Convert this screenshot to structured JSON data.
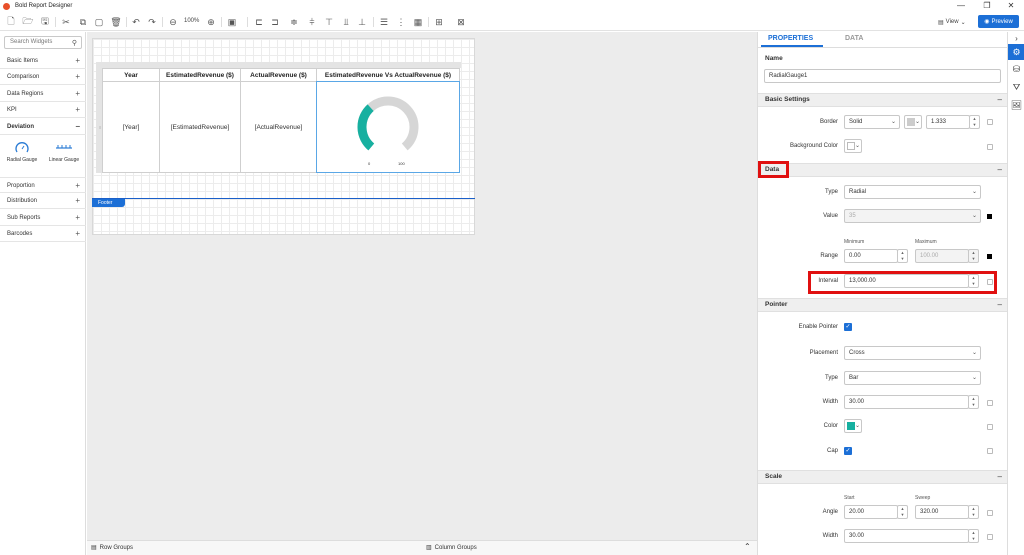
{
  "app": {
    "title": "Bold Report Designer",
    "window_controls": [
      "—",
      "❐",
      "✕"
    ]
  },
  "toolbar": {
    "zoom": "100%",
    "view_label": "View",
    "preview_label": "Preview"
  },
  "left": {
    "search_placeholder": "Search Widgets",
    "categories": [
      {
        "label": "Basic Items",
        "sign": "+"
      },
      {
        "label": "Comparison",
        "sign": "+"
      },
      {
        "label": "Data Regions",
        "sign": "+"
      },
      {
        "label": "KPI",
        "sign": "+"
      },
      {
        "label": "Deviation",
        "sign": "−"
      },
      {
        "label": "Proportion",
        "sign": "+"
      },
      {
        "label": "Distribution",
        "sign": "+"
      },
      {
        "label": "Sub Reports",
        "sign": "+"
      },
      {
        "label": "Barcodes",
        "sign": "+"
      }
    ],
    "widgets": [
      {
        "label": "Radial Gauge"
      },
      {
        "label": "Linear Gauge"
      }
    ]
  },
  "report": {
    "headers": [
      "Year",
      "EstimatedRevenue ($)",
      "ActualRevenue ($)",
      "EstimatedRevenue Vs ActualRevenue ($)"
    ],
    "cells": [
      "[Year]",
      "[EstimatedRevenue]",
      "[ActualRevenue]"
    ],
    "gauge": {
      "min_label": "0",
      "max_label": "100",
      "value_fraction": 0.35,
      "track_color": "#d6d6d6",
      "value_color": "#17b0a0"
    },
    "footer_label": "Footer"
  },
  "bottom": {
    "row_groups": "Row Groups",
    "column_groups": "Column Groups"
  },
  "props": {
    "tabs": [
      "PROPERTIES",
      "DATA"
    ],
    "name_label": "Name",
    "name_value": "RadialGauge1",
    "sections": {
      "basic": "Basic Settings",
      "data": "Data",
      "pointer": "Pointer",
      "scale": "Scale"
    },
    "border": {
      "label": "Border",
      "style": "Solid",
      "width": "1.333"
    },
    "background": {
      "label": "Background Color"
    },
    "type": {
      "label": "Type",
      "value": "Radial"
    },
    "value": {
      "label": "Value",
      "value": "35"
    },
    "range": {
      "label": "Range",
      "min_label": "Minimum",
      "max_label": "Maximum",
      "min": "0.00",
      "max": "100.00"
    },
    "interval": {
      "label": "Interval",
      "value": "13,000.00"
    },
    "enable_pointer": {
      "label": "Enable Pointer"
    },
    "placement": {
      "label": "Placement",
      "value": "Cross"
    },
    "ptype": {
      "label": "Type",
      "value": "Bar"
    },
    "pwidth": {
      "label": "Width",
      "value": "30.00"
    },
    "pcolor": {
      "label": "Color",
      "color": "#17b0a0"
    },
    "cap": {
      "label": "Cap"
    },
    "angle": {
      "label": "Angle",
      "start_label": "Start",
      "sweep_label": "Sweep",
      "start": "20.00",
      "sweep": "320.00"
    },
    "swidth": {
      "label": "Width",
      "value": "30.00"
    }
  },
  "colors": {
    "accent": "#1c6fd6",
    "highlight": "#e01010"
  }
}
